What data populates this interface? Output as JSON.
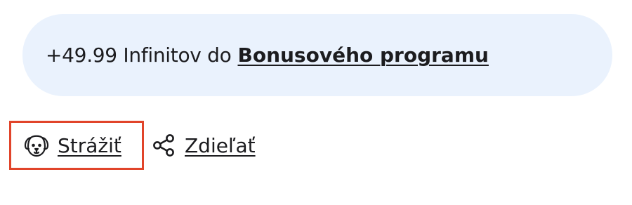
{
  "bonus_banner": {
    "prefix": "+49.99 Infinitov do",
    "link_text": "Bonusového programu"
  },
  "actions": {
    "watch": {
      "label": "Strážiť",
      "icon": "dog-icon"
    },
    "share": {
      "label": "Zdieľať",
      "icon": "share-icon"
    }
  },
  "colors": {
    "banner_background": "#eaf2fd",
    "highlight_border": "#e1442a",
    "text": "#1c1c1f"
  }
}
